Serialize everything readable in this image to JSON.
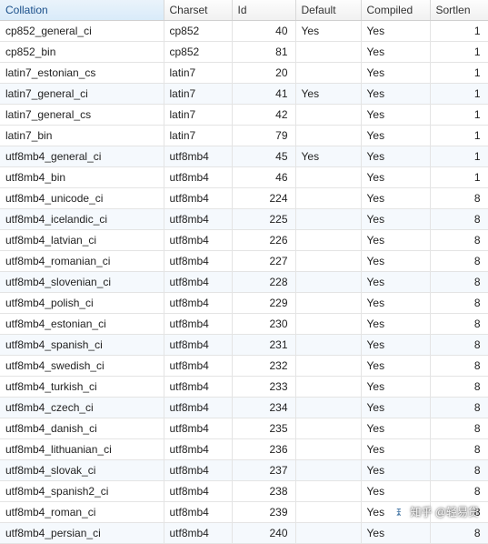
{
  "columns": {
    "collation": "Collation",
    "charset": "Charset",
    "id": "Id",
    "default": "Default",
    "compiled": "Compiled",
    "sortlen": "Sortlen"
  },
  "chart_data": {
    "type": "table",
    "title": "",
    "columns": [
      "Collation",
      "Charset",
      "Id",
      "Default",
      "Compiled",
      "Sortlen"
    ],
    "rows": [
      [
        "cp852_general_ci",
        "cp852",
        40,
        "Yes",
        "Yes",
        1
      ],
      [
        "cp852_bin",
        "cp852",
        81,
        "",
        "Yes",
        1
      ],
      [
        "latin7_estonian_cs",
        "latin7",
        20,
        "",
        "Yes",
        1
      ],
      [
        "latin7_general_ci",
        "latin7",
        41,
        "Yes",
        "Yes",
        1
      ],
      [
        "latin7_general_cs",
        "latin7",
        42,
        "",
        "Yes",
        1
      ],
      [
        "latin7_bin",
        "latin7",
        79,
        "",
        "Yes",
        1
      ],
      [
        "utf8mb4_general_ci",
        "utf8mb4",
        45,
        "Yes",
        "Yes",
        1
      ],
      [
        "utf8mb4_bin",
        "utf8mb4",
        46,
        "",
        "Yes",
        1
      ],
      [
        "utf8mb4_unicode_ci",
        "utf8mb4",
        224,
        "",
        "Yes",
        8
      ],
      [
        "utf8mb4_icelandic_ci",
        "utf8mb4",
        225,
        "",
        "Yes",
        8
      ],
      [
        "utf8mb4_latvian_ci",
        "utf8mb4",
        226,
        "",
        "Yes",
        8
      ],
      [
        "utf8mb4_romanian_ci",
        "utf8mb4",
        227,
        "",
        "Yes",
        8
      ],
      [
        "utf8mb4_slovenian_ci",
        "utf8mb4",
        228,
        "",
        "Yes",
        8
      ],
      [
        "utf8mb4_polish_ci",
        "utf8mb4",
        229,
        "",
        "Yes",
        8
      ],
      [
        "utf8mb4_estonian_ci",
        "utf8mb4",
        230,
        "",
        "Yes",
        8
      ],
      [
        "utf8mb4_spanish_ci",
        "utf8mb4",
        231,
        "",
        "Yes",
        8
      ],
      [
        "utf8mb4_swedish_ci",
        "utf8mb4",
        232,
        "",
        "Yes",
        8
      ],
      [
        "utf8mb4_turkish_ci",
        "utf8mb4",
        233,
        "",
        "Yes",
        8
      ],
      [
        "utf8mb4_czech_ci",
        "utf8mb4",
        234,
        "",
        "Yes",
        8
      ],
      [
        "utf8mb4_danish_ci",
        "utf8mb4",
        235,
        "",
        "Yes",
        8
      ],
      [
        "utf8mb4_lithuanian_ci",
        "utf8mb4",
        236,
        "",
        "Yes",
        8
      ],
      [
        "utf8mb4_slovak_ci",
        "utf8mb4",
        237,
        "",
        "Yes",
        8
      ],
      [
        "utf8mb4_spanish2_ci",
        "utf8mb4",
        238,
        "",
        "Yes",
        8
      ],
      [
        "utf8mb4_roman_ci",
        "utf8mb4",
        239,
        "",
        "Yes",
        8
      ],
      [
        "utf8mb4_persian_ci",
        "utf8mb4",
        240,
        "",
        "Yes",
        8
      ]
    ]
  },
  "alt_rows": [
    3,
    6,
    9,
    12,
    15,
    18,
    21,
    24
  ],
  "watermark": "知乎 @轻易贷"
}
